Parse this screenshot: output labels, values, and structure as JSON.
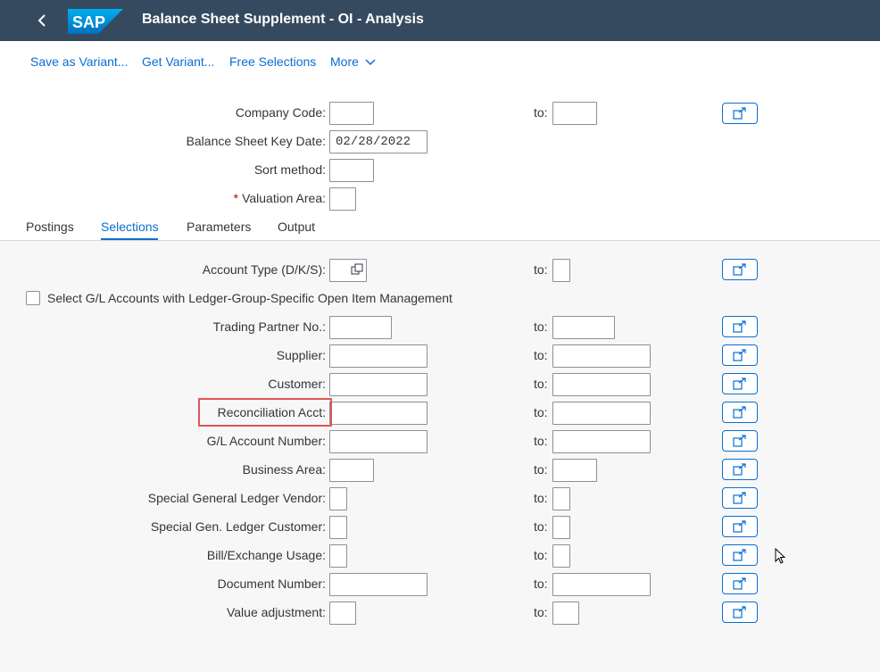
{
  "app": {
    "title": "Balance Sheet Supplement - OI - Analysis",
    "logo_text": "SAP",
    "brand_color": "#0a6ed1",
    "header_color": "#354a5f"
  },
  "toolbar": {
    "save_variant": "Save as Variant...",
    "get_variant": "Get Variant...",
    "free_selections": "Free Selections",
    "more": "More"
  },
  "header_fields": {
    "company_code": {
      "label": "Company Code:",
      "value": "",
      "to_label": "to:",
      "to_value": ""
    },
    "key_date": {
      "label": "Balance Sheet Key Date:",
      "value": "02/28/2022"
    },
    "sort_method": {
      "label": "Sort method:",
      "value": ""
    },
    "valuation_area": {
      "label": "Valuation Area:",
      "required_mark": "*",
      "value": ""
    }
  },
  "tabs": [
    {
      "label": "Postings",
      "active": false
    },
    {
      "label": "Selections",
      "active": true
    },
    {
      "label": "Parameters",
      "active": false
    },
    {
      "label": "Output",
      "active": false
    }
  ],
  "selections": {
    "account_type": {
      "label": "Account Type (D/K/S):",
      "value": "",
      "to_label": "to:",
      "to_value": ""
    },
    "ledger_group_checkbox": {
      "label": "Select G/L Accounts with Ledger-Group-Specific Open Item Management",
      "checked": false
    },
    "rows": [
      {
        "label": "Trading Partner No.:",
        "to_label": "to:"
      },
      {
        "label": "Supplier:",
        "to_label": "to:"
      },
      {
        "label": "Customer:",
        "to_label": "to:"
      },
      {
        "label": "Reconciliation Acct:",
        "to_label": "to:",
        "highlighted": true
      },
      {
        "label": "G/L Account Number:",
        "to_label": "to:"
      },
      {
        "label": "Business Area:",
        "to_label": "to:"
      },
      {
        "label": "Special General Ledger Vendor:",
        "to_label": "to:"
      },
      {
        "label": "Special Gen. Ledger Customer:",
        "to_label": "to:"
      },
      {
        "label": "Bill/Exchange Usage:",
        "to_label": "to:"
      },
      {
        "label": "Document Number:",
        "to_label": "to:"
      },
      {
        "label": "Value adjustment:",
        "to_label": "to:"
      }
    ]
  },
  "icons": {
    "back": "back-arrow-icon",
    "more": "chevron-down-icon",
    "multiple_selection": "multiple-selection-icon",
    "value_help": "value-help-icon",
    "cursor": "mouse-pointer-icon"
  },
  "highlight_color": "#e05555"
}
